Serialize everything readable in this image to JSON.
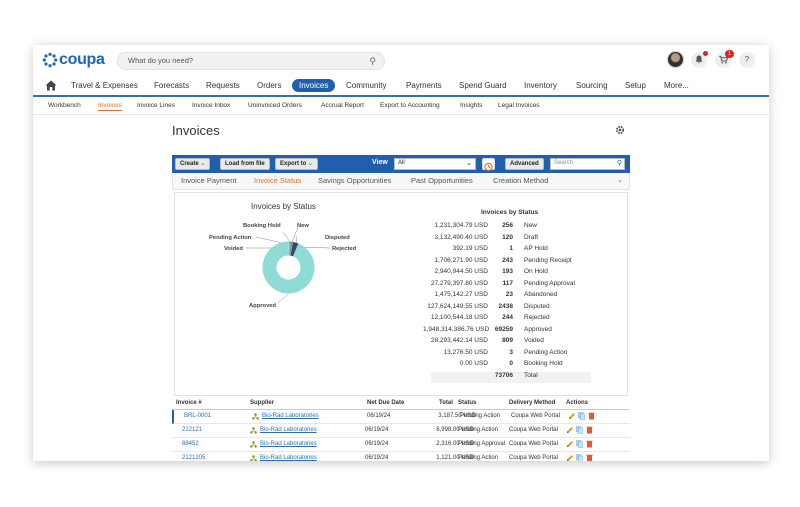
{
  "app": {
    "logo_text": "coupa",
    "search_placeholder": "What do you need?",
    "notifications_badge": "1",
    "help_label": "?"
  },
  "main_nav": [
    "Travel & Expenses",
    "Forecasts",
    "Requests",
    "Orders",
    "Invoices",
    "Community",
    "Payments",
    "Spend Guard",
    "Inventory",
    "Sourcing",
    "Setup",
    "More..."
  ],
  "sub_nav": [
    "Workbench",
    "Invoices",
    "Invoice Lines",
    "Invoice Inbox",
    "Uninvoiced Orders",
    "Accrual Report",
    "Export to Accounting",
    "Insights",
    "Legal Invoices"
  ],
  "page": {
    "title": "Invoices"
  },
  "toolbar": {
    "create": "Create",
    "load": "Load from file",
    "export": "Export to",
    "view_label": "View",
    "view_value": "All",
    "advanced": "Advanced",
    "search_placeholder": "Search"
  },
  "tabs": [
    "Invoice Payment",
    "Invoice Status",
    "Savings Opportunities",
    "Past Opportunities",
    "Creation Method"
  ],
  "chart": {
    "title": "Invoices by Status",
    "labels": {
      "booking_hold": "Booking Hold",
      "new": "New",
      "pending_action": "Pending Action",
      "disputed": "Disputed",
      "voided": "Voided",
      "rejected": "Rejected",
      "approved": "Approved"
    }
  },
  "chart_data": {
    "type": "pie",
    "title": "Invoices by Status",
    "categories": [
      "New",
      "Draft",
      "AP Hold",
      "Pending Receipt",
      "On Hold",
      "Pending Approval",
      "Abandoned",
      "Disputed",
      "Rejected",
      "Approved",
      "Voided",
      "Pending Action",
      "Booking Hold"
    ],
    "values": [
      256,
      120,
      1,
      243,
      193,
      117,
      23,
      2438,
      244,
      69259,
      809,
      3,
      0
    ],
    "amounts_usd": [
      "1,231,304.79",
      "3,132,490.40",
      "392.19",
      "1,706,271.90",
      "2,940,944.50",
      "27,279,397.80",
      "1,475,142.27",
      "127,624,149.55",
      "12,100,544.18",
      "1,948,314,386.76",
      "28,293,442.14",
      "13,276.50",
      "0.00"
    ],
    "total_count": 73706,
    "total_label": "Total",
    "currency": "USD",
    "stats_title": "Invoices by Status"
  },
  "table": {
    "headers": [
      "Invoice #",
      "Supplier",
      "Net Due Date",
      "Total",
      "Status",
      "Delivery Method",
      "Actions"
    ],
    "rows": [
      {
        "invoice": "BRL-0001",
        "supplier": "Bio-Rad Laboratories",
        "due": "06/19/24",
        "total": "3,187.50 USD",
        "status": "Pending Action",
        "delivery": "Coupa Web Portal"
      },
      {
        "invoice": "212121",
        "supplier": "Bio-Rad Laboratories",
        "due": "06/19/24",
        "total": "6,998.00 USD",
        "status": "Pending Action",
        "delivery": "Coupa Web Portal"
      },
      {
        "invoice": "88452",
        "supplier": "Bio-Rad Laboratories",
        "due": "06/19/24",
        "total": "2,316.00 USD",
        "status": "Pending Approval",
        "delivery": "Coupa Web Portal"
      },
      {
        "invoice": "2121205",
        "supplier": "Bio-Rad Laboratories",
        "due": "06/19/24",
        "total": "1,121.00 USD",
        "status": "Pending Action",
        "delivery": "Coupa Web Portal"
      }
    ]
  },
  "colors": {
    "brand_blue": "#1f5fae",
    "accent_orange": "#e0712b",
    "donut_teal": "#8fdcd6"
  }
}
